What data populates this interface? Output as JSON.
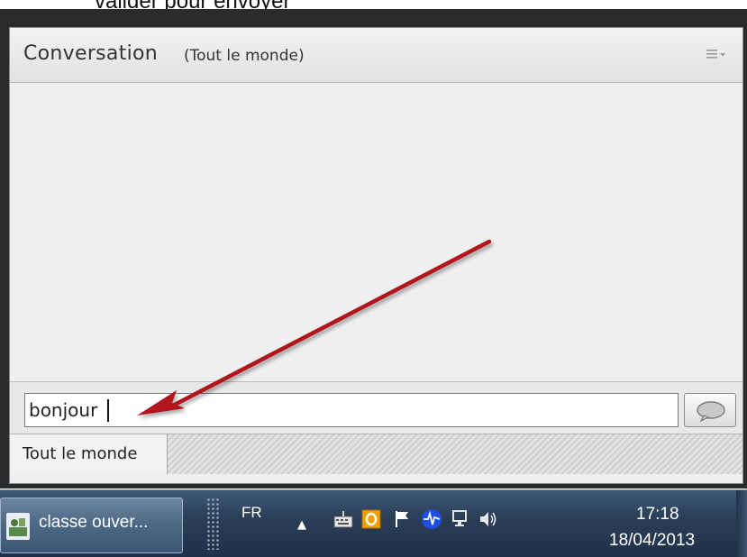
{
  "caption": {
    "text": "valider pour envoyer"
  },
  "panel": {
    "title": "Conversation",
    "subtitle": "(Tout le monde)",
    "menu_icon": "options-menu-icon"
  },
  "chat": {
    "input_value": "bonjour",
    "send_icon": "speech-bubble-icon"
  },
  "audience_tab": {
    "label": "Tout le monde"
  },
  "taskbar": {
    "task_label": "classe ouver...",
    "language": "FR",
    "tray_icons": [
      "show-hidden-icons",
      "keyboard-icon",
      "office-icon",
      "action-center-flag-icon",
      "network-activity-icon",
      "network-icon",
      "volume-icon"
    ],
    "time": "17:18",
    "date": "18/04/2013"
  },
  "colors": {
    "arrow": "#b0141c",
    "panel_bg": "#efefef",
    "taskbar": "#2a3f58"
  }
}
